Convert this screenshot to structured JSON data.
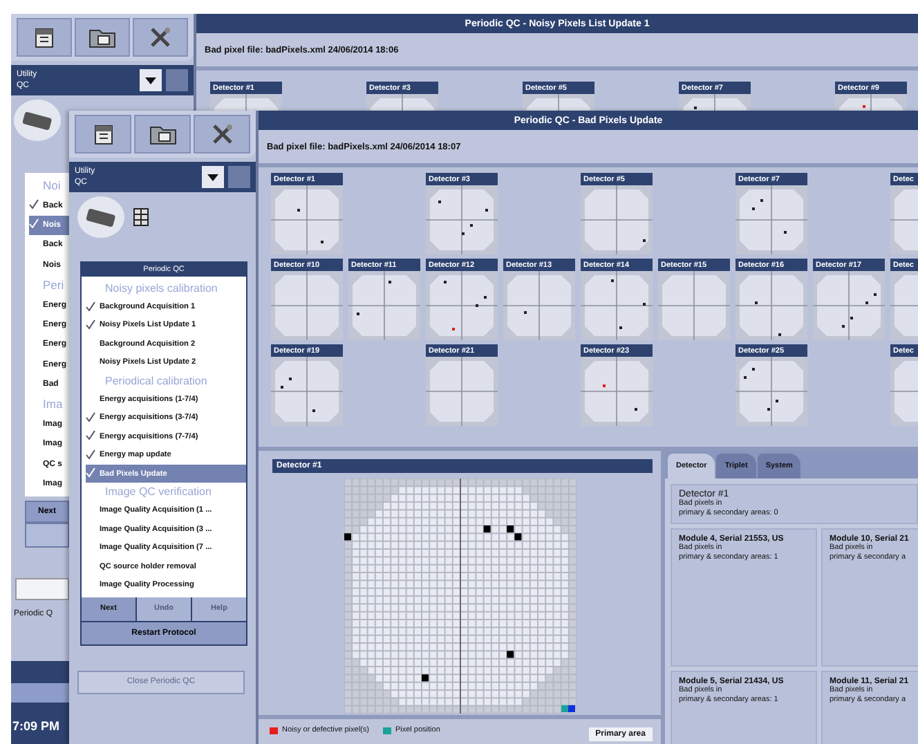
{
  "back_window": {
    "title": "Periodic QC - Noisy Pixels List Update 1",
    "file_line": "Bad pixel file: badPixels.xml  24/06/2014 18:06",
    "dropdown": {
      "lines": [
        "Utility",
        "QC"
      ]
    },
    "detectors": [
      "Detector #1",
      "Detector #3",
      "Detector #5",
      "Detector #7",
      "Detector #9"
    ],
    "list": [
      {
        "kind": "header",
        "text": "Noi"
      },
      {
        "kind": "item",
        "text": "Back",
        "checked": true,
        "selected": false
      },
      {
        "kind": "item",
        "text": "Nois",
        "checked": true,
        "selected": true
      },
      {
        "kind": "item",
        "text": "Back",
        "checked": false,
        "selected": false
      },
      {
        "kind": "item",
        "text": "Nois",
        "checked": false,
        "selected": false
      },
      {
        "kind": "header",
        "text": "Peri"
      },
      {
        "kind": "item",
        "text": "Energ",
        "checked": false,
        "selected": false
      },
      {
        "kind": "item",
        "text": "Energ",
        "checked": false,
        "selected": false
      },
      {
        "kind": "item",
        "text": "Energ",
        "checked": false,
        "selected": false
      },
      {
        "kind": "item",
        "text": "Energ",
        "checked": false,
        "selected": false
      },
      {
        "kind": "item",
        "text": "Bad",
        "checked": false,
        "selected": false
      },
      {
        "kind": "header",
        "text": "Ima"
      },
      {
        "kind": "item",
        "text": "Imag",
        "checked": false,
        "selected": false
      },
      {
        "kind": "item",
        "text": "Imag",
        "checked": false,
        "selected": false
      },
      {
        "kind": "item",
        "text": "QC s",
        "checked": false,
        "selected": false
      },
      {
        "kind": "item",
        "text": "Imag",
        "checked": false,
        "selected": false
      }
    ],
    "next_button": "Next",
    "status_text": "Periodic Q",
    "clock": "7:09 PM"
  },
  "front_window": {
    "title": "Periodic QC - Bad Pixels Update",
    "file_line": "Bad pixel file: badPixels.xml  24/06/2014 18:07",
    "dropdown": {
      "lines": [
        "Utility",
        "QC"
      ]
    },
    "protocol": {
      "title": "Periodic QC",
      "list": [
        {
          "kind": "header",
          "text": "Noisy pixels calibration"
        },
        {
          "kind": "item",
          "text": "Background Acquisition 1",
          "checked": true,
          "selected": false
        },
        {
          "kind": "item",
          "text": "Noisy Pixels List Update 1",
          "checked": true,
          "selected": false
        },
        {
          "kind": "item",
          "text": "Background Acquisition 2",
          "checked": false,
          "selected": false
        },
        {
          "kind": "item",
          "text": "Noisy Pixels List Update 2",
          "checked": false,
          "selected": false
        },
        {
          "kind": "header",
          "text": "Periodical calibration"
        },
        {
          "kind": "item",
          "text": "Energy acquisitions (1-7/4)",
          "checked": false,
          "selected": false
        },
        {
          "kind": "item",
          "text": "Energy acquisitions (3-7/4)",
          "checked": true,
          "selected": false
        },
        {
          "kind": "item",
          "text": "Energy acquisitions (7-7/4)",
          "checked": true,
          "selected": false
        },
        {
          "kind": "item",
          "text": "Energy map update",
          "checked": true,
          "selected": false
        },
        {
          "kind": "item",
          "text": "Bad Pixels Update",
          "checked": true,
          "selected": true
        },
        {
          "kind": "header",
          "text": "Image QC verification"
        },
        {
          "kind": "item",
          "text": "Image Quality Acquisition (1 ...",
          "checked": false,
          "selected": false
        },
        {
          "kind": "item",
          "text": "Image Quality Acquisition (3 ...",
          "checked": false,
          "selected": false
        },
        {
          "kind": "item",
          "text": "Image Quality Acquisition (7 ...",
          "checked": false,
          "selected": false
        },
        {
          "kind": "item",
          "text": "QC source holder removal",
          "checked": false,
          "selected": false
        },
        {
          "kind": "item",
          "text": "Image Quality Processing",
          "checked": false,
          "selected": false
        }
      ],
      "buttons": [
        {
          "label": "Next",
          "disabled": false
        },
        {
          "label": "Undo",
          "disabled": true
        },
        {
          "label": "Help",
          "disabled": true
        }
      ],
      "restart_button": "Restart Protocol"
    },
    "close_button": {
      "label": "Close Periodic QC",
      "disabled": true
    },
    "detector_rows": [
      {
        "spaced": true,
        "detectors": [
          "Detector #1",
          "Detector #3",
          "Detector #5",
          "Detector #7",
          "Detec"
        ]
      },
      {
        "spaced": false,
        "detectors": [
          "Detector #10",
          "Detector #11",
          "Detector #12",
          "Detector #13",
          "Detector #14",
          "Detector #15",
          "Detector #16",
          "Detector #17",
          "Detec"
        ]
      },
      {
        "spaced": true,
        "detectors": [
          "Detector #19",
          "Detector #21",
          "Detector #23",
          "Detector #25",
          "Detec"
        ]
      }
    ],
    "detail": {
      "title": "Detector #1",
      "legend": [
        {
          "label": "Noisy or defective pixel(s)",
          "color": "#e81c1c"
        },
        {
          "label": "Pixel position",
          "color": "#1aa39a"
        }
      ],
      "area_box": "Primary area"
    },
    "tabs": [
      {
        "label": "Detector",
        "selected": true
      },
      {
        "label": "Triplet",
        "selected": false
      },
      {
        "label": "System",
        "selected": false
      }
    ],
    "info": {
      "title": "Detector #1",
      "lines": [
        "Bad pixels in",
        "primary & secondary areas: 0"
      ]
    },
    "modules": [
      {
        "title": "Module 4, Serial 21553, US",
        "lines": [
          "Bad pixels in",
          "primary & secondary areas: 1"
        ]
      },
      {
        "title": "Module 10, Serial 21",
        "lines": [
          "Bad pixels in",
          "primary & secondary a"
        ]
      },
      {
        "title": "Module 5, Serial 21434, US",
        "lines": [
          "Bad pixels in",
          "primary & secondary areas: 1"
        ]
      },
      {
        "title": "Module 11, Serial 21",
        "lines": [
          "Bad pixels in",
          "primary & secondary a"
        ]
      }
    ]
  }
}
